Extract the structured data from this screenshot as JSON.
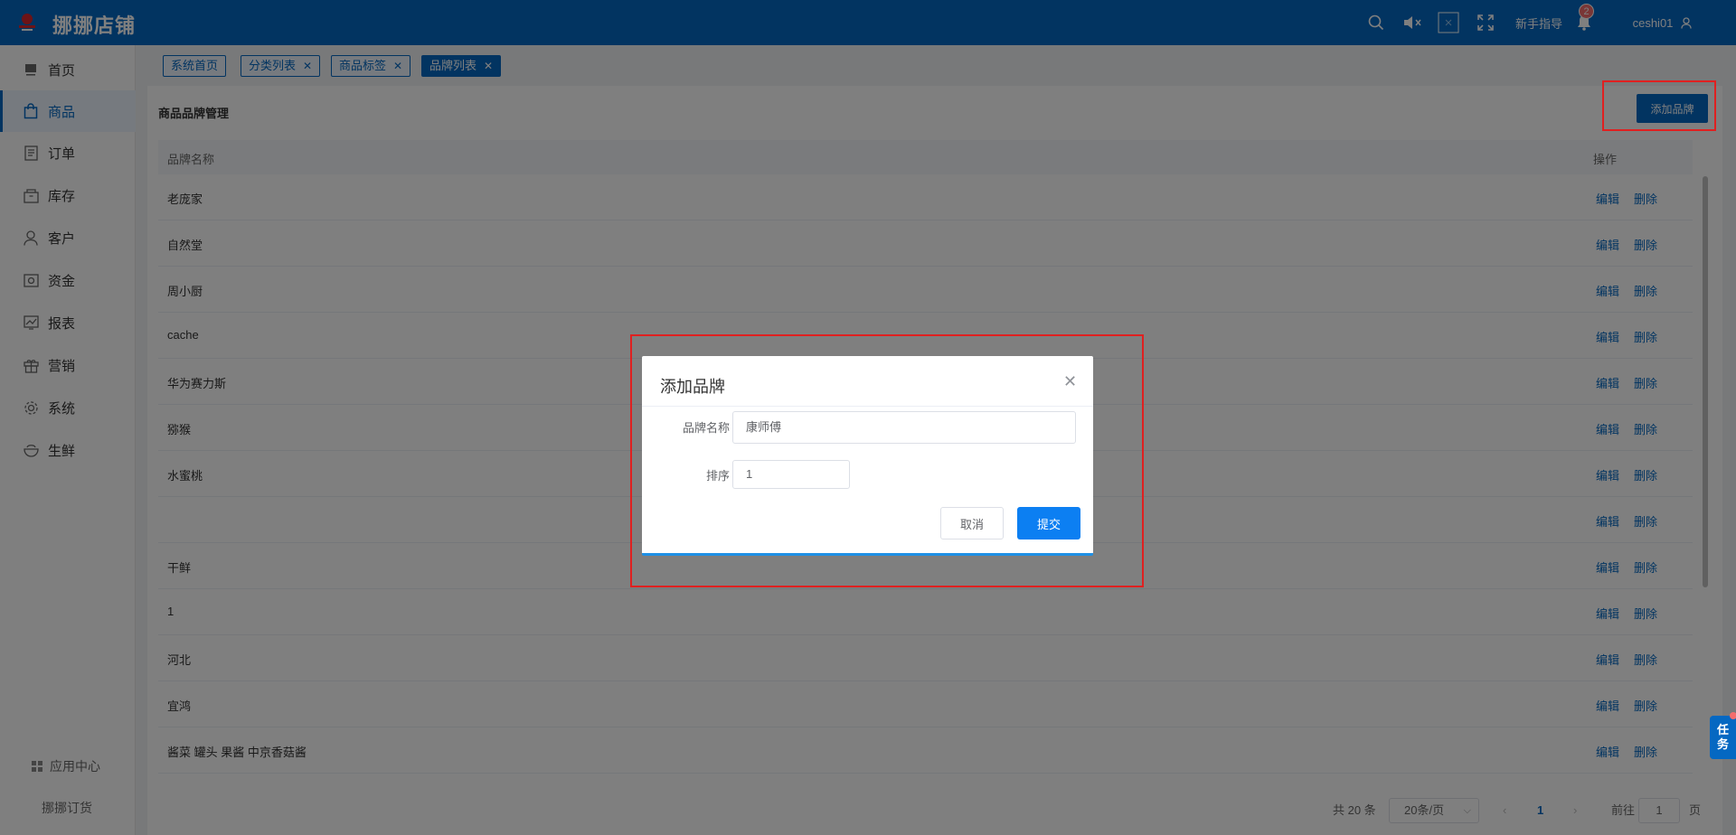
{
  "header": {
    "title": "挪挪店铺",
    "guide_label": "新手指导",
    "notification_count": "2",
    "username": "ceshi01"
  },
  "sidebar": {
    "items": [
      {
        "label": "首页",
        "icon": "monitor-icon"
      },
      {
        "label": "商品",
        "icon": "bag-icon",
        "active": true
      },
      {
        "label": "订单",
        "icon": "document-icon"
      },
      {
        "label": "库存",
        "icon": "box-icon"
      },
      {
        "label": "客户",
        "icon": "user-icon"
      },
      {
        "label": "资金",
        "icon": "wallet-icon"
      },
      {
        "label": "报表",
        "icon": "chart-icon"
      },
      {
        "label": "营销",
        "icon": "gift-icon"
      },
      {
        "label": "系统",
        "icon": "gear-icon"
      },
      {
        "label": "生鲜",
        "icon": "bowl-icon"
      }
    ],
    "app_center": "应用中心",
    "footer": "挪挪订货"
  },
  "tabs": [
    {
      "label": "系统首页"
    },
    {
      "label": "分类列表"
    },
    {
      "label": "商品标签"
    },
    {
      "label": "品牌列表",
      "active": true
    }
  ],
  "page": {
    "title": "商品品牌管理",
    "add_button": "添加品牌"
  },
  "table": {
    "columns": [
      "品牌名称",
      "操作"
    ],
    "edit_label": "编辑",
    "delete_label": "删除",
    "rows": [
      "老庞家",
      "自然堂",
      "周小厨",
      "cache",
      "华为赛力斯",
      "猕猴",
      "水蜜桃",
      "",
      "干鲜",
      "1",
      "河北",
      "宜鸿",
      "酱菜 罐头 果酱 中京香菇酱"
    ]
  },
  "pagination": {
    "total": "共 20 条",
    "page_size": "20条/页",
    "current_page": "1",
    "goto_label": "前往",
    "goto_value": "1",
    "page_suffix": "页"
  },
  "dialog": {
    "title": "添加品牌",
    "name_label": "品牌名称",
    "name_value": "康师傅",
    "sort_label": "排序",
    "sort_value": "1",
    "cancel_label": "取消",
    "submit_label": "提交"
  },
  "task_tab": "任务",
  "colors": {
    "primary": "#0568c2",
    "submit": "#0c7ff2",
    "highlight": "#e02020"
  }
}
